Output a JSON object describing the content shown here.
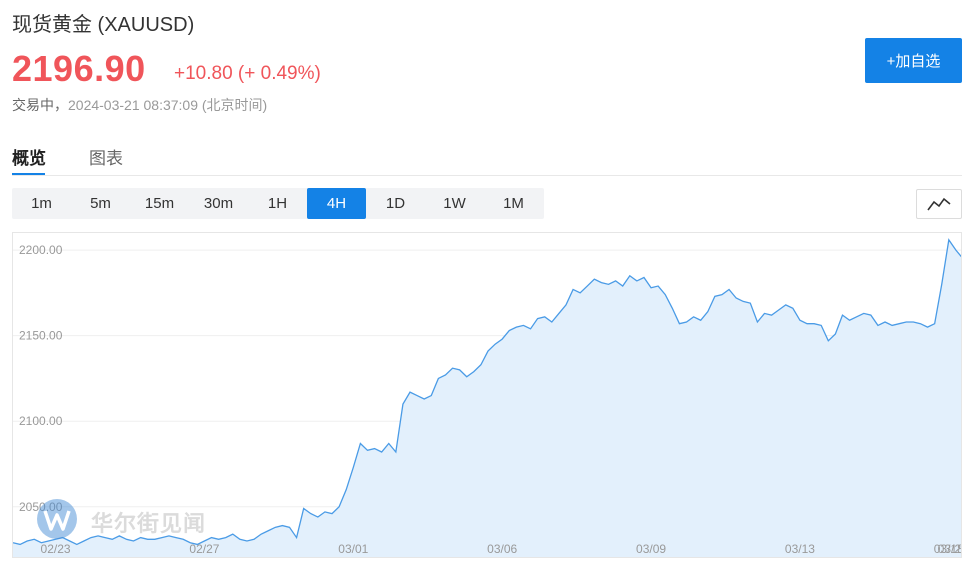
{
  "header": {
    "title": "现货黄金 (XAUUSD)",
    "price": "2196.90",
    "change": "+10.80 (+ 0.49%)",
    "status_label": "交易中，",
    "timestamp": "2024-03-21 08:37:09",
    "timezone_note": "(北京时间)",
    "add_watchlist_label": "+加自选"
  },
  "tabs": [
    {
      "label": "概览",
      "active": true
    },
    {
      "label": "图表",
      "active": false
    }
  ],
  "periods": [
    {
      "label": "1m",
      "active": false
    },
    {
      "label": "5m",
      "active": false
    },
    {
      "label": "15m",
      "active": false
    },
    {
      "label": "30m",
      "active": false
    },
    {
      "label": "1H",
      "active": false
    },
    {
      "label": "4H",
      "active": true
    },
    {
      "label": "1D",
      "active": false
    },
    {
      "label": "1W",
      "active": false
    },
    {
      "label": "1M",
      "active": false
    }
  ],
  "chart_type_icon": "line-chart-icon",
  "watermark": {
    "text": "华尔街见闻",
    "icon": "wallstreetcn-logo-icon"
  },
  "colors": {
    "accent": "#1482e6",
    "price_up": "#f0555a",
    "line": "#4a9be6",
    "area": "#e3f0fc",
    "grid": "#efefef"
  },
  "chart_data": {
    "type": "area",
    "title": "",
    "xlabel": "",
    "ylabel": "",
    "ylim": [
      2030,
      2210
    ],
    "yticks": [
      "2050.00",
      "2100.00",
      "2150.00",
      "2200.00"
    ],
    "xticks": [
      {
        "label": "02/23",
        "index": 6
      },
      {
        "label": "02/27",
        "index": 27
      },
      {
        "label": "03/01",
        "index": 48
      },
      {
        "label": "03/06",
        "index": 69
      },
      {
        "label": "03/09",
        "index": 90
      },
      {
        "label": "03/13",
        "index": 111
      },
      {
        "label": "03/18",
        "index": 132
      },
      {
        "label": "03/2",
        "index": 153
      }
    ],
    "grid": true,
    "series": [
      {
        "values": [
          2029,
          2028,
          2030,
          2031,
          2029,
          2030,
          2031,
          2032,
          2030,
          2028,
          2030,
          2032,
          2033,
          2032,
          2031,
          2033,
          2031,
          2030,
          2032,
          2031,
          2031,
          2032,
          2033,
          2032,
          2031,
          2029,
          2028,
          2030,
          2032,
          2031,
          2032,
          2034,
          2031,
          2030,
          2031,
          2034,
          2036,
          2038,
          2039,
          2038,
          2032,
          2049,
          2046,
          2044,
          2047,
          2046,
          2050,
          2060,
          2073,
          2087,
          2083,
          2084,
          2082,
          2087,
          2082,
          2110,
          2117,
          2115,
          2113,
          2115,
          2125,
          2127,
          2131,
          2130,
          2126,
          2129,
          2133,
          2141,
          2145,
          2148,
          2153,
          2155,
          2156,
          2154,
          2160,
          2161,
          2158,
          2163,
          2168,
          2177,
          2175,
          2179,
          2183,
          2181,
          2180,
          2182,
          2179,
          2185,
          2182,
          2184,
          2178,
          2179,
          2174,
          2166,
          2157,
          2158,
          2161,
          2159,
          2164,
          2173,
          2174,
          2177,
          2172,
          2170,
          2169,
          2158,
          2163,
          2162,
          2165,
          2168,
          2166,
          2159,
          2157,
          2157,
          2156,
          2147,
          2151,
          2162,
          2159,
          2161,
          2163,
          2162,
          2156,
          2158,
          2156,
          2157,
          2158,
          2158,
          2157,
          2155,
          2157,
          2180,
          2206,
          2200,
          2195
        ]
      }
    ]
  }
}
